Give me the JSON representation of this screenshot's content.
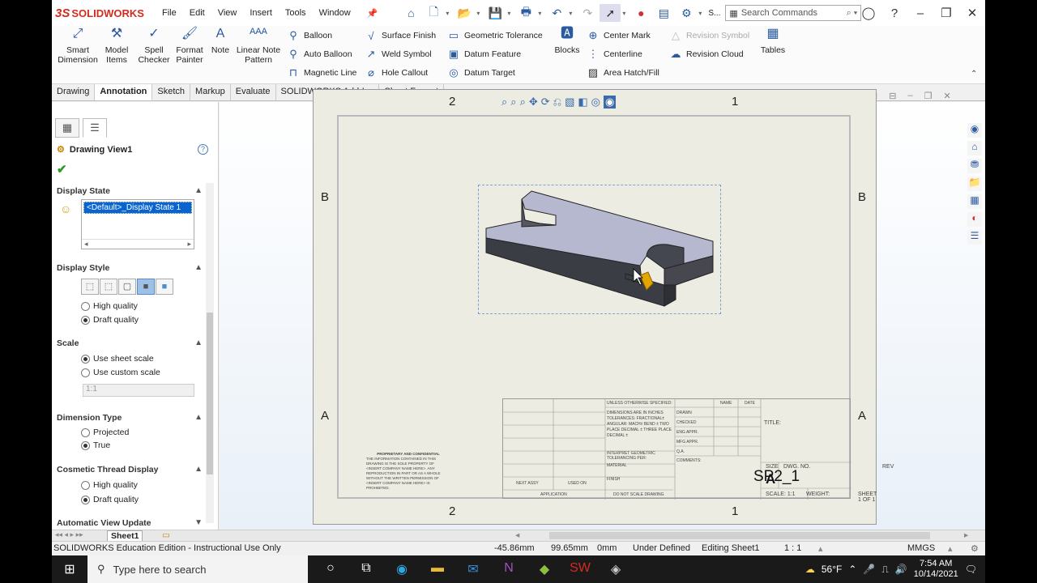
{
  "app": {
    "brand": "SOLIDWORKS"
  },
  "menu": [
    "File",
    "Edit",
    "View",
    "Insert",
    "Tools",
    "Window"
  ],
  "search": {
    "placeholder": "Search Commands",
    "prefix": "S..."
  },
  "ribbon": {
    "smart_dimension": "Smart Dimension",
    "model_items": "Model Items",
    "spell_checker": "Spell Checker",
    "format_painter": "Format Painter",
    "note": "Note",
    "linear_note_pattern": "Linear Note Pattern",
    "balloon": "Balloon",
    "auto_balloon": "Auto Balloon",
    "magnetic_line": "Magnetic Line",
    "surface_finish": "Surface Finish",
    "weld_symbol": "Weld Symbol",
    "hole_callout": "Hole Callout",
    "geometric_tolerance": "Geometric Tolerance",
    "datum_feature": "Datum Feature",
    "datum_target": "Datum Target",
    "blocks": "Blocks",
    "center_mark": "Center Mark",
    "centerline": "Centerline",
    "area_hatch": "Area Hatch/Fill",
    "revision_symbol": "Revision Symbol",
    "revision_cloud": "Revision Cloud",
    "tables": "Tables"
  },
  "tabs": [
    "Drawing",
    "Annotation",
    "Sketch",
    "Markup",
    "Evaluate",
    "SOLIDWORKS Add-Ins",
    "Sheet Format"
  ],
  "panel": {
    "title": "Drawing View1",
    "display_state_header": "Display State",
    "display_state_value": "<Default>_Display State 1",
    "display_style_header": "Display Style",
    "high_quality": "High quality",
    "draft_quality": "Draft quality",
    "scale_header": "Scale",
    "use_sheet_scale": "Use sheet scale",
    "use_custom_scale": "Use custom scale",
    "scale_value": "1:1",
    "dimension_type_header": "Dimension Type",
    "projected": "Projected",
    "true": "True",
    "cosmetic_header": "Cosmetic Thread Display",
    "cos_high": "High quality",
    "cos_draft": "Draft quality",
    "auto_view_update": "Automatic View Update"
  },
  "sheet": {
    "zone_top_2": "2",
    "zone_top_1": "1",
    "zone_b": "B",
    "zone_a": "A",
    "title_label": "TITLE:",
    "size_label": "SIZE",
    "size_value": "A",
    "dwg_no_label": "DWG.  NO.",
    "dwg_no": "SP2_1",
    "rev_label": "REV",
    "scale_label": "SCALE: 1:1",
    "weight_label": "WEIGHT:",
    "sheet_label": "SHEET 1 OF 1",
    "unless": "UNLESS OTHERWISE SPECIFIED:",
    "name": "NAME",
    "date": "DATE",
    "drawn": "DRAWN",
    "checked": "CHECKED",
    "eng_appr": "ENG APPR.",
    "mfg_appr": "MFG APPR.",
    "qa": "Q.A.",
    "comments": "COMMENTS:",
    "dims": "DIMENSIONS ARE IN INCHES TOLERANCES: FRACTIONAL± ANGULAR: MACH± BEND ± TWO PLACE DECIMAL ± THREE PLACE DECIMAL ±",
    "interpret": "INTERPRET GEOMETRIC TOLERANCING PER:",
    "material": "MATERIAL",
    "finish": "FINISH",
    "next_assy": "NEXT ASSY",
    "used_on": "USED ON",
    "application": "APPLICATION",
    "do_not_scale": "DO NOT SCALE DRAWING",
    "prop_title": "PROPRIETARY AND CONFIDENTIAL",
    "prop_text": "THE INFORMATION CONTAINED IN THIS DRAWING IS THE SOLE PROPERTY OF <INSERT COMPANY NAME HERE>. ANY REPRODUCTION IN PART OR AS A WHOLE WITHOUT THE WRITTEN PERMISSION OF <INSERT COMPANY NAME HERE> IS PROHIBITED."
  },
  "sheet_tab": "Sheet1",
  "status": {
    "edition": "SOLIDWORKS Education Edition - Instructional Use Only",
    "x": "-45.86mm",
    "y": "99.65mm",
    "z": "0mm",
    "state": "Under Defined",
    "editing": "Editing Sheet1",
    "scale": "1 : 1",
    "units": "MMGS"
  },
  "taskbar": {
    "search": "Type here to search",
    "temp": "56°F",
    "time": "7:54 AM",
    "date": "10/14/2021"
  }
}
